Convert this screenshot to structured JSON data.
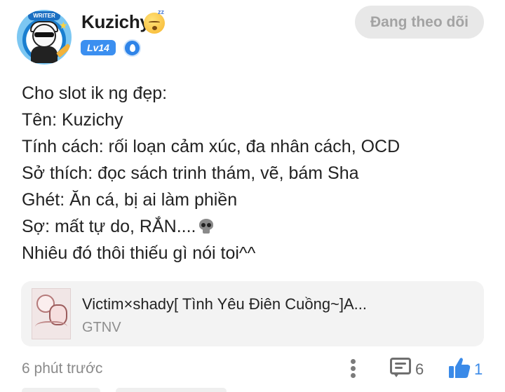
{
  "header": {
    "username": "Kuzichy",
    "level_badge": "Lv14",
    "avatar_badge_text": "WRITER",
    "follow_button_label": "Đang theo dõi"
  },
  "post": {
    "lines": [
      "Cho slot ik ng đẹp:",
      "Tên: Kuzichy",
      "Tính cách: rối loạn cảm xúc, đa nhân cách, OCD",
      "Sở thích: đọc sách trinh thám, vẽ, bám Sha",
      "Ghét: Ăn cá, bị ai làm phiền",
      "Sợ: mất tự do, RẮN....",
      "Nhiêu đó thôi thiếu gì nói toi^^"
    ]
  },
  "linked_item": {
    "title": "Victim×shady[ Tình Yêu Điên Cuồng~]A...",
    "subtitle": "GTNV"
  },
  "footer": {
    "timestamp": "6 phút trước",
    "comment_count": "6",
    "like_count": "1"
  },
  "colors": {
    "accent_blue": "#3a8ae8",
    "follow_button_bg": "#e8e8e8",
    "follow_button_text": "#a3a3a3",
    "card_bg": "#f3f3f3"
  },
  "icons": [
    "sleeping-face-emoji",
    "rank-drop-icon",
    "skull-emoji",
    "more-vertical-icon",
    "comment-icon",
    "thumbs-up-icon"
  ]
}
